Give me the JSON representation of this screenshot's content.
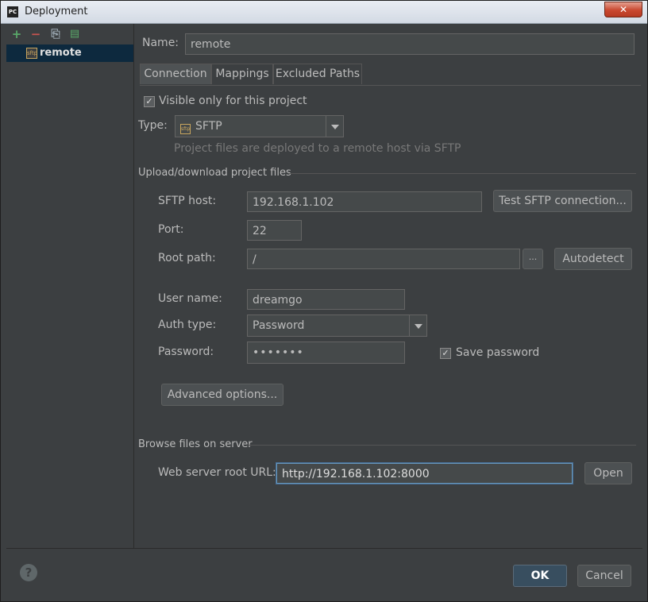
{
  "window": {
    "title": "Deployment",
    "app_icon_text": "PC",
    "close_symbol": "✕"
  },
  "sidebar": {
    "toolbar": [
      {
        "name": "add-server-button",
        "icon": "plus-icon",
        "glyph": "+",
        "color": "#59a869"
      },
      {
        "name": "remove-server-button",
        "icon": "minus-icon",
        "glyph": "−",
        "color": "#c75450"
      },
      {
        "name": "copy-server-button",
        "icon": "copy-icon",
        "glyph": "⎘",
        "color": "#9aa7b0"
      },
      {
        "name": "use-as-default-button",
        "icon": "default-server-icon",
        "glyph": "▤",
        "color": "#59a869"
      }
    ],
    "items": [
      {
        "label": "remote",
        "icon": "sftp-server-icon"
      }
    ]
  },
  "form": {
    "name_label": "Name:",
    "name_value": "remote",
    "tabs": [
      "Connection",
      "Mappings",
      "Excluded Paths"
    ],
    "active_tab": "Connection",
    "visible_only_label": "Visible only for this project",
    "visible_only_checked": true,
    "type_label": "Type:",
    "type_value": "SFTP",
    "type_hint": "Project files are deployed to a remote host via SFTP",
    "upload_section": "Upload/download project files",
    "sftp_host_label": "SFTP host:",
    "sftp_host_value": "192.168.1.102",
    "test_button": "Test SFTP connection...",
    "port_label": "Port:",
    "port_value": "22",
    "root_path_label": "Root path:",
    "root_path_value": "/",
    "browse_button": "...",
    "autodetect_button": "Autodetect",
    "user_name_label": "User name:",
    "user_name_value": "dreamgo",
    "auth_type_label": "Auth type:",
    "auth_type_value": "Password",
    "password_label": "Password:",
    "password_value": "•••••••",
    "save_password_label": "Save password",
    "save_password_checked": true,
    "advanced_button": "Advanced options...",
    "browse_section": "Browse files on server",
    "web_root_label": "Web server root URL:",
    "web_root_value": "http://192.168.1.102:8000",
    "open_button": "Open"
  },
  "footer": {
    "help": "?",
    "ok": "OK",
    "cancel": "Cancel"
  },
  "colors": {
    "background": "#3c3f41",
    "selection": "#0d293e",
    "accent_focus": "#6897bb"
  }
}
